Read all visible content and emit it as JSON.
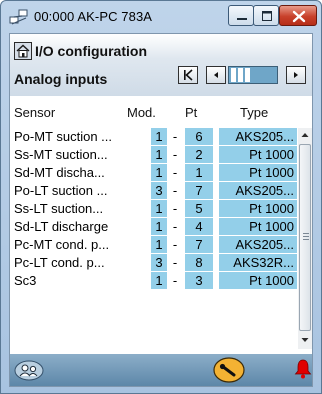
{
  "window": {
    "title": "00:000 AK-PC 783A",
    "icons": {
      "app": "network-icon",
      "minimize": "minimize-icon",
      "maximize": "maximize-icon",
      "close": "close-icon"
    }
  },
  "header": {
    "page_title": "I/O configuration",
    "section_title": "Analog inputs",
    "icons": {
      "home": "home-icon",
      "first": "first-page-icon",
      "prev": "prev-page-icon",
      "next": "next-page-icon"
    },
    "page_position": 0.3
  },
  "columns": {
    "sensor": "Sensor",
    "mod": "Mod.",
    "pt": "Pt",
    "type": "Type"
  },
  "rows": [
    {
      "name": "Po-MT suction ...",
      "mod": "1",
      "sep": "-",
      "pt": "6",
      "type": "AKS205..."
    },
    {
      "name": "Ss-MT suction...",
      "mod": "1",
      "sep": "-",
      "pt": "2",
      "type": "Pt 1000"
    },
    {
      "name": "Sd-MT discha...",
      "mod": "1",
      "sep": "-",
      "pt": "1",
      "type": "Pt 1000"
    },
    {
      "name": "Po-LT suction ...",
      "mod": "3",
      "sep": "-",
      "pt": "7",
      "type": "AKS205..."
    },
    {
      "name": "Ss-LT suction...",
      "mod": "1",
      "sep": "-",
      "pt": "5",
      "type": "Pt 1000"
    },
    {
      "name": "Sd-LT discharge",
      "mod": "1",
      "sep": "-",
      "pt": "4",
      "type": "Pt 1000"
    },
    {
      "name": "Pc-MT cond. p...",
      "mod": "1",
      "sep": "-",
      "pt": "7",
      "type": "AKS205..."
    },
    {
      "name": "Pc-LT cond. p...",
      "mod": "3",
      "sep": "-",
      "pt": "8",
      "type": "AKS32R..."
    },
    {
      "name": "Sc3",
      "mod": "1",
      "sep": "-",
      "pt": "3",
      "type": "Pt 1000"
    }
  ],
  "footer": {
    "icons": {
      "users": "users-icon",
      "service": "service-tool-icon",
      "alarm": "alarm-bell-icon"
    }
  },
  "colors": {
    "cell_bg": "#93cfe9",
    "footer_bg": "#6f95b5",
    "alarm": "#e00000",
    "tool": "#f3b233"
  }
}
